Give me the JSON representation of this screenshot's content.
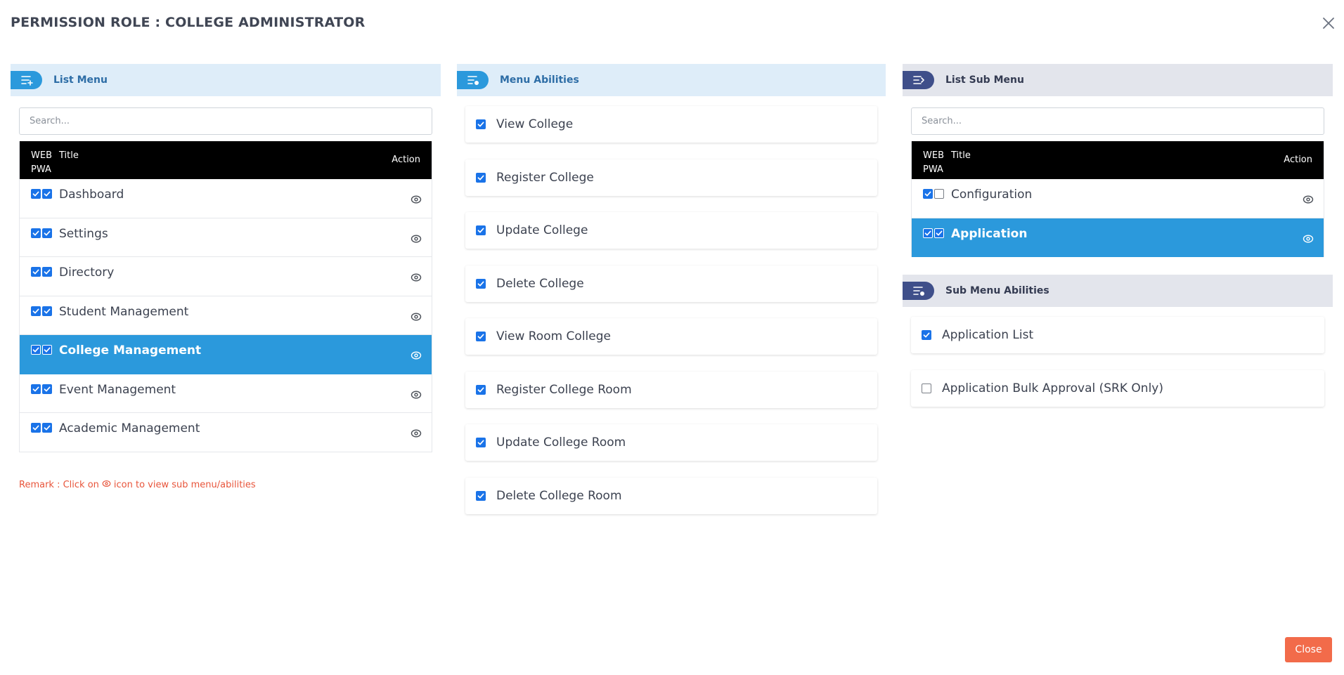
{
  "modal": {
    "title": "PERMISSION ROLE : COLLEGE ADMINISTRATOR",
    "close_button": "Close"
  },
  "colors": {
    "accent_blue": "#2b99dc",
    "checkbox_blue": "#1a73e8",
    "navy": "#3f4f8a",
    "close_button": "#f26b4a",
    "remark_text": "#e8553b"
  },
  "list_menu": {
    "header": "List Menu",
    "search_placeholder": "Search...",
    "columns": {
      "web": "WEB",
      "pwa": "PWA",
      "title": "Title",
      "action": "Action"
    },
    "rows": [
      {
        "title": "Dashboard",
        "web": true,
        "pwa": true,
        "selected": false
      },
      {
        "title": "Settings",
        "web": true,
        "pwa": true,
        "selected": false
      },
      {
        "title": "Directory",
        "web": true,
        "pwa": true,
        "selected": false
      },
      {
        "title": "Student Management",
        "web": true,
        "pwa": true,
        "selected": false
      },
      {
        "title": "College Management",
        "web": true,
        "pwa": true,
        "selected": true
      },
      {
        "title": "Event Management",
        "web": true,
        "pwa": true,
        "selected": false
      },
      {
        "title": "Academic Management",
        "web": true,
        "pwa": true,
        "selected": false
      }
    ],
    "remark_prefix": "Remark : Click on",
    "remark_suffix": "icon to view sub menu/abilities"
  },
  "menu_abilities": {
    "header": "Menu Abilities",
    "items": [
      {
        "label": "View College",
        "checked": true
      },
      {
        "label": "Register College",
        "checked": true
      },
      {
        "label": "Update College",
        "checked": true
      },
      {
        "label": "Delete College",
        "checked": true
      },
      {
        "label": "View Room College",
        "checked": true
      },
      {
        "label": "Register College Room",
        "checked": true
      },
      {
        "label": "Update College Room",
        "checked": true
      },
      {
        "label": "Delete College Room",
        "checked": true
      }
    ]
  },
  "list_sub_menu": {
    "header": "List Sub Menu",
    "search_placeholder": "Search...",
    "columns": {
      "web": "WEB",
      "pwa": "PWA",
      "title": "Title",
      "action": "Action"
    },
    "rows": [
      {
        "title": "Configuration",
        "web": true,
        "pwa": false,
        "selected": false
      },
      {
        "title": "Application",
        "web": true,
        "pwa": true,
        "selected": true
      }
    ]
  },
  "sub_menu_abilities": {
    "header": "Sub Menu Abilities",
    "items": [
      {
        "label": "Application List",
        "checked": true
      },
      {
        "label": "Application Bulk Approval (SRK Only)",
        "checked": false
      }
    ]
  }
}
